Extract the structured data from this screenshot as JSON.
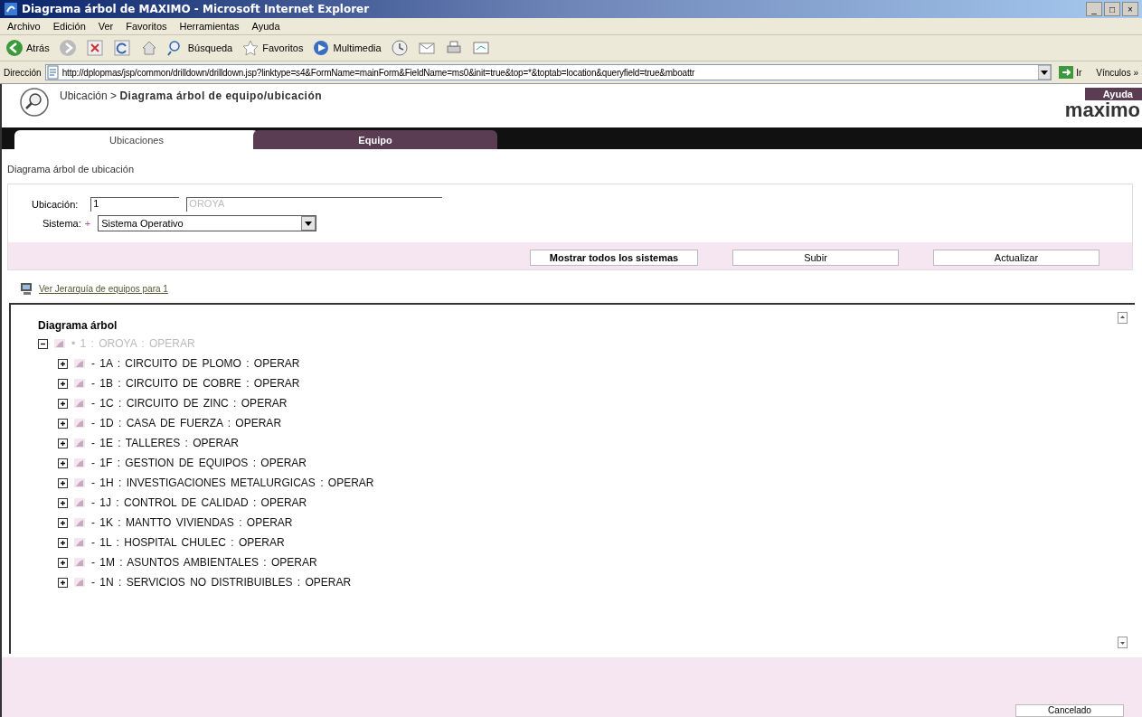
{
  "window": {
    "title": "Diagrama árbol de MAXIMO - Microsoft Internet Explorer",
    "controls": [
      "_",
      "□",
      "×"
    ]
  },
  "menu": [
    "Archivo",
    "Edición",
    "Ver",
    "Favoritos",
    "Herramientas",
    "Ayuda"
  ],
  "toolbar": [
    {
      "kind": "back",
      "label": "Atrás"
    },
    {
      "kind": "forward"
    },
    {
      "kind": "stop"
    },
    {
      "kind": "refresh"
    },
    {
      "kind": "home"
    },
    {
      "kind": "search",
      "label": "Búsqueda"
    },
    {
      "kind": "favorites",
      "label": "Favoritos"
    },
    {
      "kind": "media",
      "label": "Multimedia"
    },
    {
      "kind": "history"
    },
    {
      "kind": "mail"
    },
    {
      "kind": "print"
    },
    {
      "kind": "edit"
    }
  ],
  "address_bar": {
    "label": "Dirección",
    "value": "http://dplopmas/jsp/common/drilldown/drilldown.jsp?linktype=s4&FormName=mainForm&FieldName=ms0&init=true&top=*&toptab=location&queryfield=true&mboattr",
    "go": "Ir",
    "links": "Vínculos »"
  },
  "header": {
    "breadcrumb": "Ubicación > **Diagrama árbol de equipo/ubicación**",
    "help": "Ayuda",
    "logo": "maximo"
  },
  "tabs": [
    {
      "label": "Ubicaciones",
      "selected": true
    },
    {
      "label": "Equipo",
      "selected": false
    }
  ],
  "section_title": "Diagrama árbol de ubicación",
  "form": {
    "location_label": "Ubicación:",
    "location_value": "1",
    "location_description": "OROYA",
    "system_label": "Sistema:",
    "system_marker": "+",
    "system_value": "Sistema Operativo"
  },
  "buttons": [
    "Mostrar todos los sistemas",
    "Subir",
    "Actualizar"
  ],
  "hierarchy_link": "Ver Jerarquía de equipos para 1",
  "tree": {
    "title": "Diagrama árbol",
    "nodes": [
      {
        "label": "• 1 : OROYA : OPERAR",
        "expanded": true,
        "disabled": true,
        "children": [
          {
            "label": "- 1A : CIRCUITO DE PLOMO : OPERAR",
            "expanded": false,
            "disabled": false
          },
          {
            "label": "- 1B : CIRCUITO DE COBRE : OPERAR",
            "expanded": false,
            "disabled": false
          },
          {
            "label": "- 1C : CIRCUITO DE ZINC : OPERAR",
            "expanded": false,
            "disabled": false
          },
          {
            "label": "- 1D : CASA DE FUERZA : OPERAR",
            "expanded": false,
            "disabled": false
          },
          {
            "label": "- 1E : TALLERES : OPERAR",
            "expanded": false,
            "disabled": false
          },
          {
            "label": "- 1F : GESTION DE EQUIPOS : OPERAR",
            "expanded": false,
            "disabled": false
          },
          {
            "label": "- 1H : INVESTIGACIONES METALURGICAS : OPERAR",
            "expanded": false,
            "disabled": false
          },
          {
            "label": "- 1J : CONTROL DE CALIDAD : OPERAR",
            "expanded": false,
            "disabled": false
          },
          {
            "label": "- 1K : MANTTO VIVIENDAS : OPERAR",
            "expanded": false,
            "disabled": false
          },
          {
            "label": "- 1L : HOSPITAL CHULEC : OPERAR",
            "expanded": false,
            "disabled": false
          },
          {
            "label": "- 1M : ASUNTOS AMBIENTALES : OPERAR",
            "expanded": false,
            "disabled": false
          },
          {
            "label": "- 1N : SERVICIOS NO DISTRIBUIBLES : OPERAR",
            "expanded": false,
            "disabled": false
          }
        ]
      }
    ]
  },
  "footer_button": "Cancelado"
}
